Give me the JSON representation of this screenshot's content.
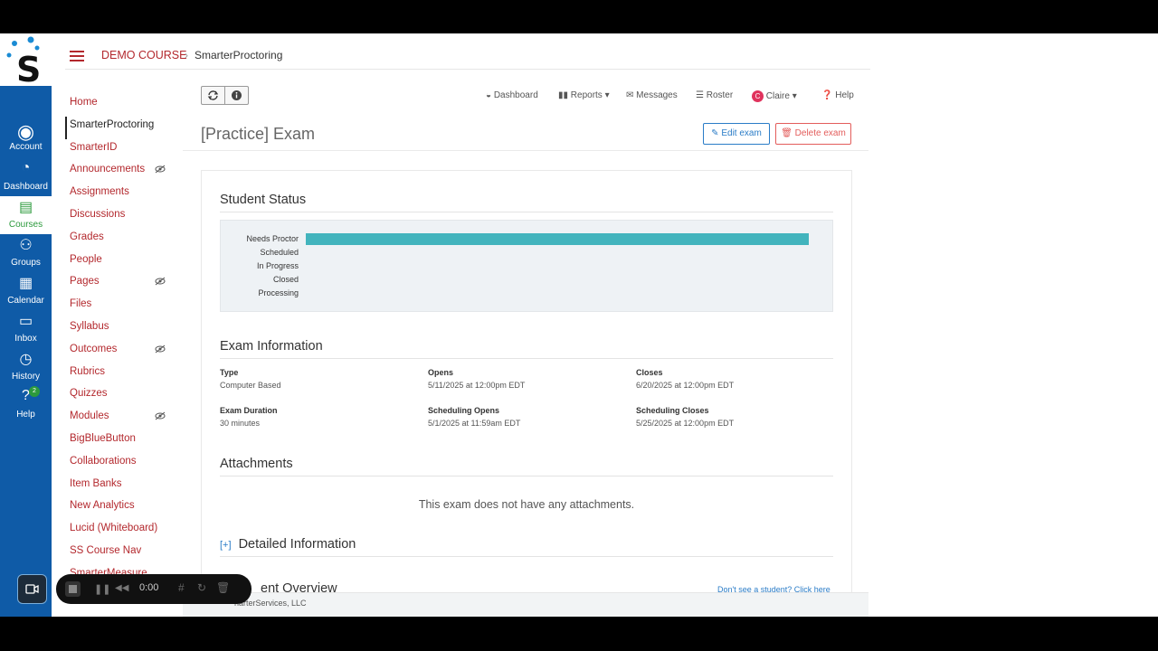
{
  "global_nav": {
    "items": [
      {
        "label": "Account",
        "icon": "account-icon"
      },
      {
        "label": "Dashboard",
        "icon": "dashboard-icon"
      },
      {
        "label": "Courses",
        "icon": "courses-icon"
      },
      {
        "label": "Groups",
        "icon": "groups-icon"
      },
      {
        "label": "Calendar",
        "icon": "calendar-icon"
      },
      {
        "label": "Inbox",
        "icon": "inbox-icon"
      },
      {
        "label": "History",
        "icon": "history-icon"
      },
      {
        "label": "Help",
        "icon": "help-icon",
        "badge": "2"
      }
    ],
    "active": "Courses",
    "color": "#0f5ba7"
  },
  "breadcrumb": {
    "course": "DEMO COURSE",
    "page": "SmarterProctoring"
  },
  "course_nav": {
    "items": [
      {
        "label": "Home"
      },
      {
        "label": "SmarterProctoring",
        "active": true
      },
      {
        "label": "SmarterID"
      },
      {
        "label": "Announcements",
        "hidden": true
      },
      {
        "label": "Assignments"
      },
      {
        "label": "Discussions"
      },
      {
        "label": "Grades"
      },
      {
        "label": "People"
      },
      {
        "label": "Pages",
        "hidden": true
      },
      {
        "label": "Files"
      },
      {
        "label": "Syllabus"
      },
      {
        "label": "Outcomes",
        "hidden": true
      },
      {
        "label": "Rubrics"
      },
      {
        "label": "Quizzes"
      },
      {
        "label": "Modules",
        "hidden": true
      },
      {
        "label": "BigBlueButton"
      },
      {
        "label": "Collaborations"
      },
      {
        "label": "Item Banks"
      },
      {
        "label": "New Analytics"
      },
      {
        "label": "Lucid (Whiteboard)"
      },
      {
        "label": "SS Course Nav"
      },
      {
        "label": "SmarterMeasure"
      }
    ],
    "link_color": "#b3282d"
  },
  "toolbar": {
    "dashboard": "Dashboard",
    "reports": "Reports",
    "messages": "Messages",
    "roster": "Roster",
    "user": "Claire",
    "user_initial": "C",
    "help": "Help"
  },
  "exam": {
    "title": "[Practice] Exam",
    "edit_label": "Edit exam",
    "delete_label": "Delete exam"
  },
  "student_status": {
    "heading": "Student Status",
    "rows": [
      {
        "label": "Needs Proctor",
        "value": 1
      },
      {
        "label": "Scheduled",
        "value": 0
      },
      {
        "label": "In Progress",
        "value": 0
      },
      {
        "label": "Closed",
        "value": 0
      },
      {
        "label": "Processing",
        "value": 0
      }
    ],
    "bar_color": "#42b4bd"
  },
  "exam_info": {
    "heading": "Exam Information",
    "fields": [
      {
        "label": "Type",
        "value": "Computer Based"
      },
      {
        "label": "Opens",
        "value": "5/11/2025 at 12:00pm EDT"
      },
      {
        "label": "Closes",
        "value": "6/20/2025 at 12:00pm EDT"
      },
      {
        "label": "Exam Duration",
        "value": "30 minutes"
      },
      {
        "label": "Scheduling Opens",
        "value": "5/1/2025 at 11:59am EDT"
      },
      {
        "label": "Scheduling Closes",
        "value": "5/25/2025 at 12:00pm EDT"
      }
    ]
  },
  "attachments": {
    "heading": "Attachments",
    "empty": "This exam does not have any attachments."
  },
  "detailed": {
    "toggle": "[+]",
    "heading": "Detailed Information"
  },
  "overview": {
    "heading": "Student Overview",
    "visible_heading": "ent Overview",
    "link": "Don't see a student? Click here"
  },
  "footer": {
    "text": "SmarterServices, LLC",
    "visible_text": "harterServices, LLC"
  },
  "recorder": {
    "time": "0:00"
  }
}
